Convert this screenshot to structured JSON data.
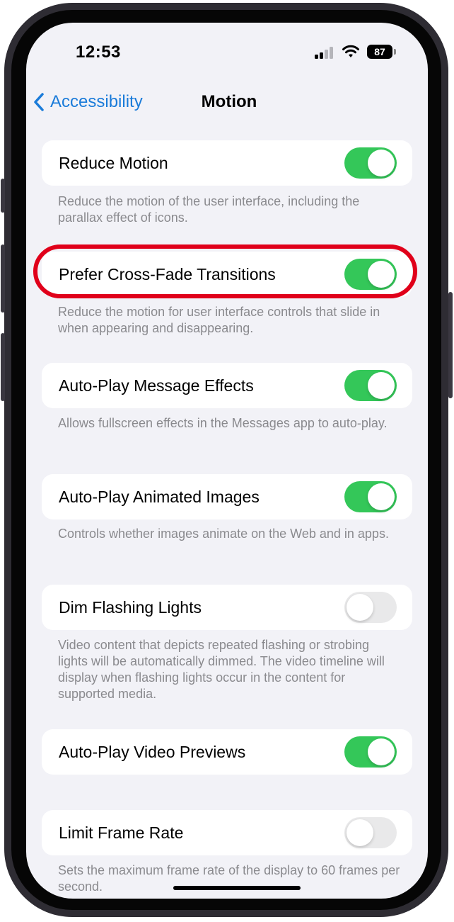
{
  "status_bar": {
    "time": "12:53",
    "battery": "87"
  },
  "nav": {
    "back_label": "Accessibility",
    "title": "Motion"
  },
  "settings": [
    {
      "label": "Reduce Motion",
      "enabled": true,
      "description": "Reduce the motion of the user interface, including the parallax effect of icons."
    },
    {
      "label": "Prefer Cross-Fade Transitions",
      "enabled": true,
      "highlighted": true,
      "description": "Reduce the motion for user interface controls that slide in when appearing and disappearing."
    },
    {
      "label": "Auto-Play Message Effects",
      "enabled": true,
      "description": "Allows fullscreen effects in the Messages app to auto-play."
    },
    {
      "label": "Auto-Play Animated Images",
      "enabled": true,
      "description": "Controls whether images animate on the Web and in apps."
    },
    {
      "label": "Dim Flashing Lights",
      "enabled": false,
      "description": "Video content that depicts repeated flashing or strobing lights will be automatically dimmed. The video timeline will display when flashing lights occur in the content for supported media."
    },
    {
      "label": "Auto-Play Video Previews",
      "enabled": true,
      "description": ""
    },
    {
      "label": "Limit Frame Rate",
      "enabled": false,
      "description": "Sets the maximum frame rate of the display to 60 frames per second."
    }
  ],
  "colors": {
    "accent": "#1a7bd9",
    "toggle_on": "#34c759",
    "toggle_off": "#e9e9ea",
    "highlight": "#e0001a",
    "background": "#f2f2f7"
  }
}
